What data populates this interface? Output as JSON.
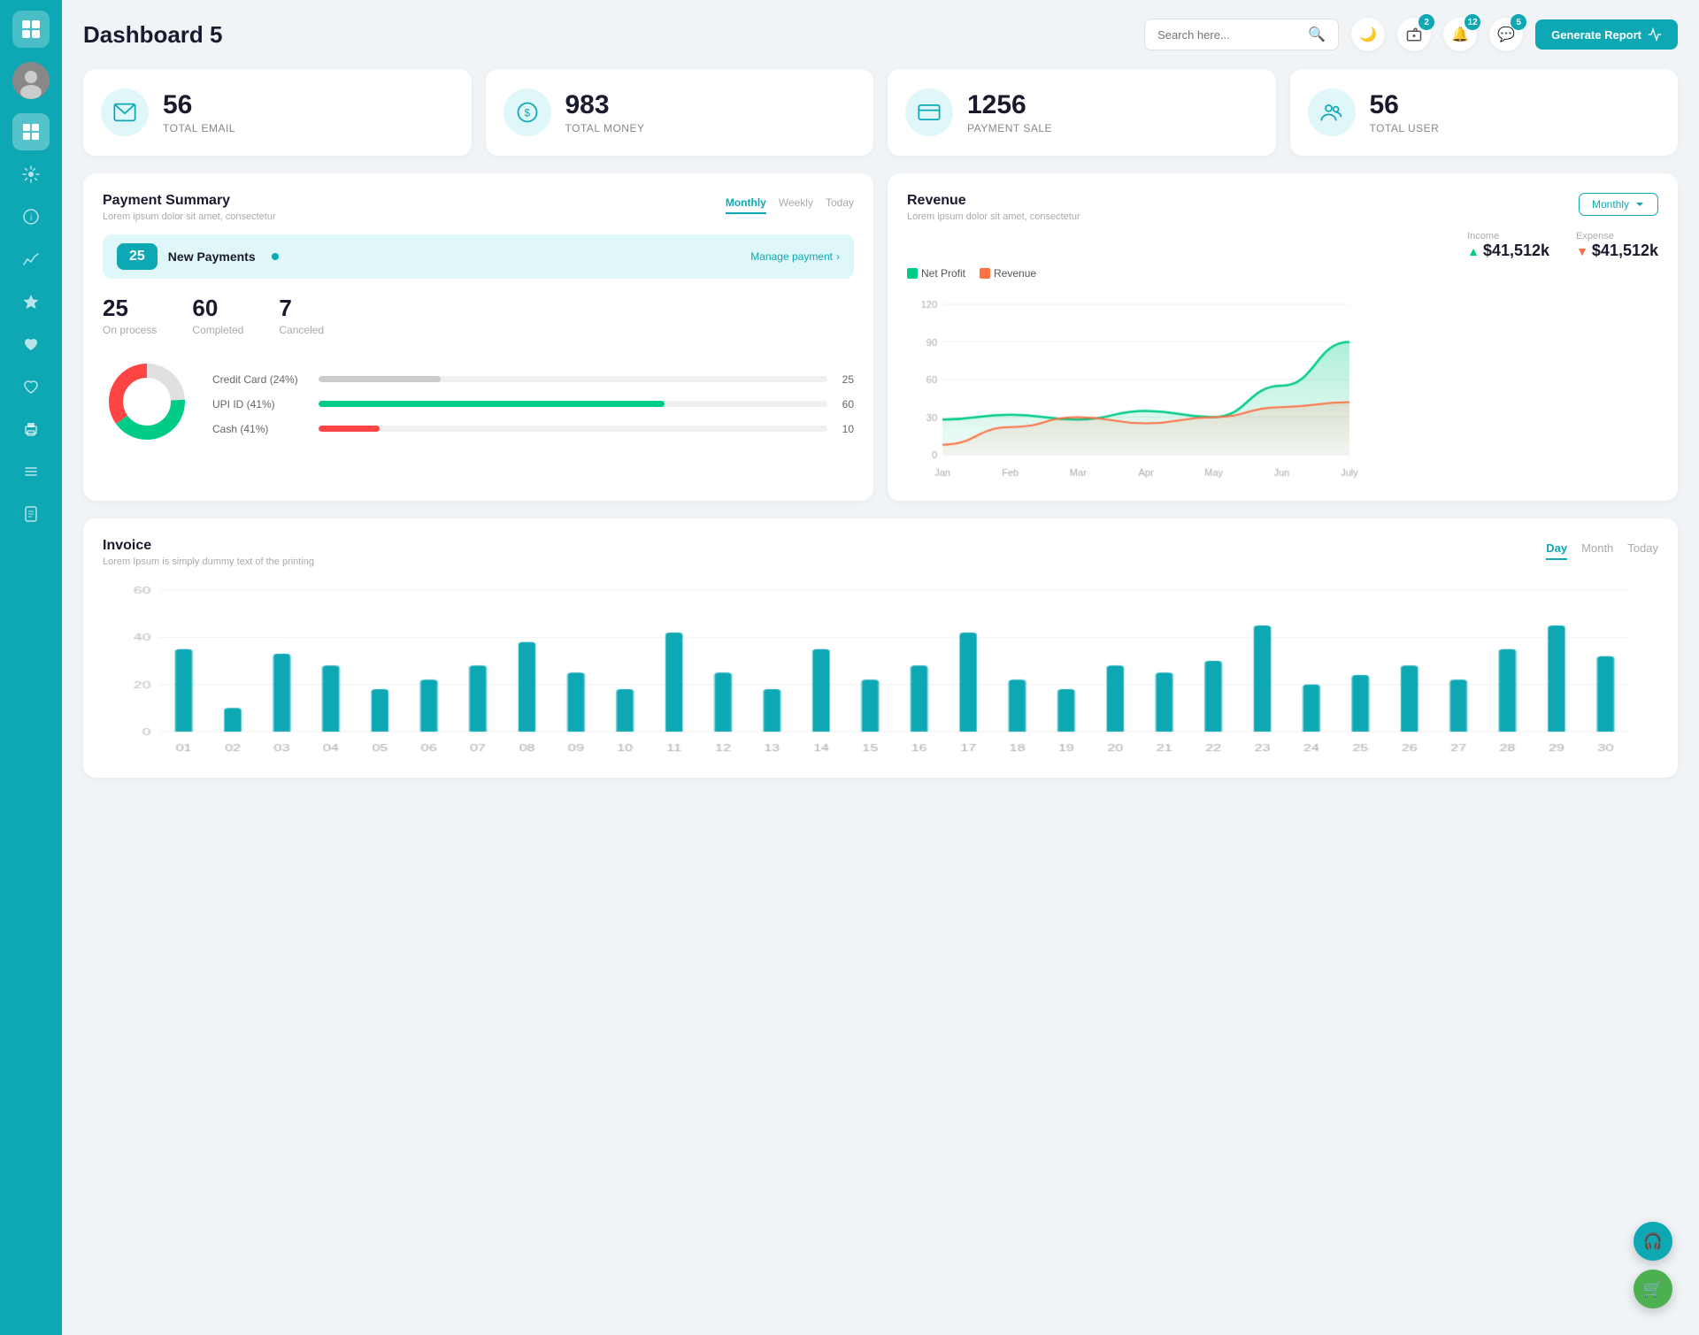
{
  "app": {
    "title": "Dashboard 5"
  },
  "header": {
    "search_placeholder": "Search here...",
    "generate_report_label": "Generate Report",
    "badges": {
      "wallet": "2",
      "bell": "12",
      "chat": "5"
    }
  },
  "stat_cards": [
    {
      "id": "email",
      "icon": "✉",
      "number": "56",
      "label": "TOTAL EMAIL"
    },
    {
      "id": "money",
      "icon": "$",
      "number": "983",
      "label": "TOTAL MONEY"
    },
    {
      "id": "payment",
      "icon": "💳",
      "number": "1256",
      "label": "PAYMENT SALE"
    },
    {
      "id": "user",
      "icon": "👥",
      "number": "56",
      "label": "TOTAL USER"
    }
  ],
  "payment_summary": {
    "title": "Payment Summary",
    "subtitle": "Lorem ipsum dolor sit amet, consectetur",
    "tabs": [
      "Monthly",
      "Weekly",
      "Today"
    ],
    "active_tab": "Monthly",
    "new_payments": {
      "count": "25",
      "label": "New Payments",
      "link": "Manage payment"
    },
    "stats": [
      {
        "num": "25",
        "label": "On process"
      },
      {
        "num": "60",
        "label": "Completed"
      },
      {
        "num": "7",
        "label": "Canceled"
      }
    ],
    "progress_bars": [
      {
        "label": "Credit Card (24%)",
        "pct": 24,
        "color": "#ccc",
        "value": "25"
      },
      {
        "label": "UPI ID (41%)",
        "pct": 68,
        "color": "#00cc88",
        "value": "60"
      },
      {
        "label": "Cash (41%)",
        "pct": 12,
        "color": "#ff4444",
        "value": "10"
      }
    ],
    "donut": {
      "segments": [
        {
          "color": "#cccccc",
          "pct": 24
        },
        {
          "color": "#00cc88",
          "pct": 41
        },
        {
          "color": "#ff4444",
          "pct": 35
        }
      ]
    }
  },
  "revenue": {
    "title": "Revenue",
    "subtitle": "Lorem ipsum dolor sit amet, consectetur",
    "dropdown_label": "Monthly",
    "income": {
      "label": "Income",
      "value": "$41,512k"
    },
    "expense": {
      "label": "Expense",
      "value": "$41,512k"
    },
    "legend": [
      {
        "label": "Net Profit",
        "color": "#00cc88"
      },
      {
        "label": "Revenue",
        "color": "#ff7043"
      }
    ],
    "chart": {
      "labels": [
        "Jan",
        "Feb",
        "Mar",
        "Apr",
        "May",
        "Jun",
        "July"
      ],
      "net_profit": [
        28,
        32,
        28,
        35,
        30,
        55,
        90
      ],
      "revenue": [
        8,
        22,
        30,
        25,
        30,
        38,
        42
      ]
    }
  },
  "invoice": {
    "title": "Invoice",
    "subtitle": "Lorem Ipsum is simply dummy text of the printing",
    "tabs": [
      "Day",
      "Month",
      "Today"
    ],
    "active_tab": "Day",
    "chart": {
      "labels": [
        "01",
        "02",
        "03",
        "04",
        "05",
        "06",
        "07",
        "08",
        "09",
        "10",
        "11",
        "12",
        "13",
        "14",
        "15",
        "16",
        "17",
        "18",
        "19",
        "20",
        "21",
        "22",
        "23",
        "24",
        "25",
        "26",
        "27",
        "28",
        "29",
        "30"
      ],
      "values": [
        35,
        10,
        33,
        28,
        18,
        22,
        28,
        38,
        25,
        18,
        42,
        25,
        18,
        35,
        22,
        28,
        42,
        22,
        18,
        28,
        25,
        30,
        45,
        20,
        24,
        28,
        22,
        35,
        45,
        32
      ],
      "y_labels": [
        "0",
        "20",
        "40",
        "60"
      ],
      "color": "#0da8b4"
    }
  },
  "sidebar": {
    "items": [
      {
        "id": "wallet",
        "icon": "💼",
        "active": false
      },
      {
        "id": "dashboard",
        "icon": "▦",
        "active": true
      },
      {
        "id": "settings",
        "icon": "⚙",
        "active": false
      },
      {
        "id": "info",
        "icon": "ℹ",
        "active": false
      },
      {
        "id": "chart",
        "icon": "📊",
        "active": false
      },
      {
        "id": "star",
        "icon": "★",
        "active": false
      },
      {
        "id": "heart1",
        "icon": "♥",
        "active": false
      },
      {
        "id": "heart2",
        "icon": "♥",
        "active": false
      },
      {
        "id": "print",
        "icon": "🖨",
        "active": false
      },
      {
        "id": "list",
        "icon": "☰",
        "active": false
      },
      {
        "id": "doc",
        "icon": "📋",
        "active": false
      }
    ]
  },
  "fab": [
    {
      "id": "support",
      "icon": "🎧",
      "color": "#0da8b4"
    },
    {
      "id": "cart",
      "icon": "🛒",
      "color": "#4caf50"
    }
  ]
}
